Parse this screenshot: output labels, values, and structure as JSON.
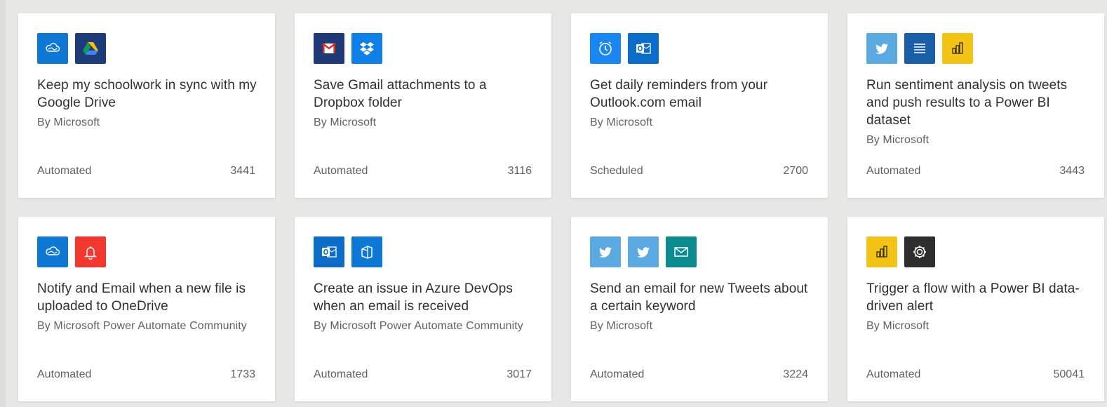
{
  "colors": {
    "onedrive": "#0f78d4",
    "gdrive": "#1e3c7a",
    "gmail": "#203a79",
    "dropbox": "#0d7fe6",
    "schedule": "#1a86f2",
    "outlook": "#0a6cc8",
    "twitter": "#5aa9e0",
    "text_analytics": "#1a5ea8",
    "powerbi": "#f3c316",
    "notifications": "#f2382e",
    "azure_devops": "#0d78d6",
    "mail": "#0b8a8f",
    "flow_button": "#2e2e2e"
  },
  "templates": [
    {
      "icons": [
        {
          "name": "onedrive-icon",
          "color": "#0f78d4"
        },
        {
          "name": "google-drive-icon",
          "color": "#1e3c7a"
        }
      ],
      "title": "Keep my schoolwork in sync with my Google Drive",
      "author": "By Microsoft",
      "type": "Automated",
      "count": "3441"
    },
    {
      "icons": [
        {
          "name": "gmail-icon",
          "color": "#203a79"
        },
        {
          "name": "dropbox-icon",
          "color": "#0d7fe6"
        }
      ],
      "title": "Save Gmail attachments to a Dropbox folder",
      "author": "By Microsoft",
      "type": "Automated",
      "count": "3116"
    },
    {
      "icons": [
        {
          "name": "schedule-icon",
          "color": "#1a86f2"
        },
        {
          "name": "outlook-icon",
          "color": "#0a6cc8"
        }
      ],
      "title": "Get daily reminders from your Outlook.com email",
      "author": "By Microsoft",
      "type": "Scheduled",
      "count": "2700"
    },
    {
      "icons": [
        {
          "name": "twitter-icon",
          "color": "#5aa9e0"
        },
        {
          "name": "text-analytics-icon",
          "color": "#1a5ea8"
        },
        {
          "name": "power-bi-icon",
          "color": "#f3c316"
        }
      ],
      "title": "Run sentiment analysis on tweets and push results to a Power BI dataset",
      "author": "By Microsoft",
      "type": "Automated",
      "count": "3443"
    },
    {
      "icons": [
        {
          "name": "onedrive-icon",
          "color": "#0f78d4"
        },
        {
          "name": "notification-bell-icon",
          "color": "#f2382e"
        }
      ],
      "title": "Notify and Email when a new file is uploaded to OneDrive",
      "author": "By Microsoft Power Automate Community",
      "type": "Automated",
      "count": "1733"
    },
    {
      "icons": [
        {
          "name": "outlook-icon",
          "color": "#0a6cc8"
        },
        {
          "name": "azure-devops-icon",
          "color": "#0d78d6"
        }
      ],
      "title": "Create an issue in Azure DevOps when an email is received",
      "author": "By Microsoft Power Automate Community",
      "type": "Automated",
      "count": "3017"
    },
    {
      "icons": [
        {
          "name": "twitter-icon",
          "color": "#5aa9e0"
        },
        {
          "name": "twitter-icon",
          "color": "#5aa9e0"
        },
        {
          "name": "mail-icon",
          "color": "#0b8a8f"
        }
      ],
      "title": "Send an email for new Tweets about a certain keyword",
      "author": "By Microsoft",
      "type": "Automated",
      "count": "3224"
    },
    {
      "icons": [
        {
          "name": "power-bi-icon",
          "color": "#f3c316"
        },
        {
          "name": "settings-gear-icon",
          "color": "#2e2e2e"
        }
      ],
      "title": "Trigger a flow with a Power BI data-driven alert",
      "author": "By Microsoft",
      "type": "Automated",
      "count": "50041"
    }
  ]
}
